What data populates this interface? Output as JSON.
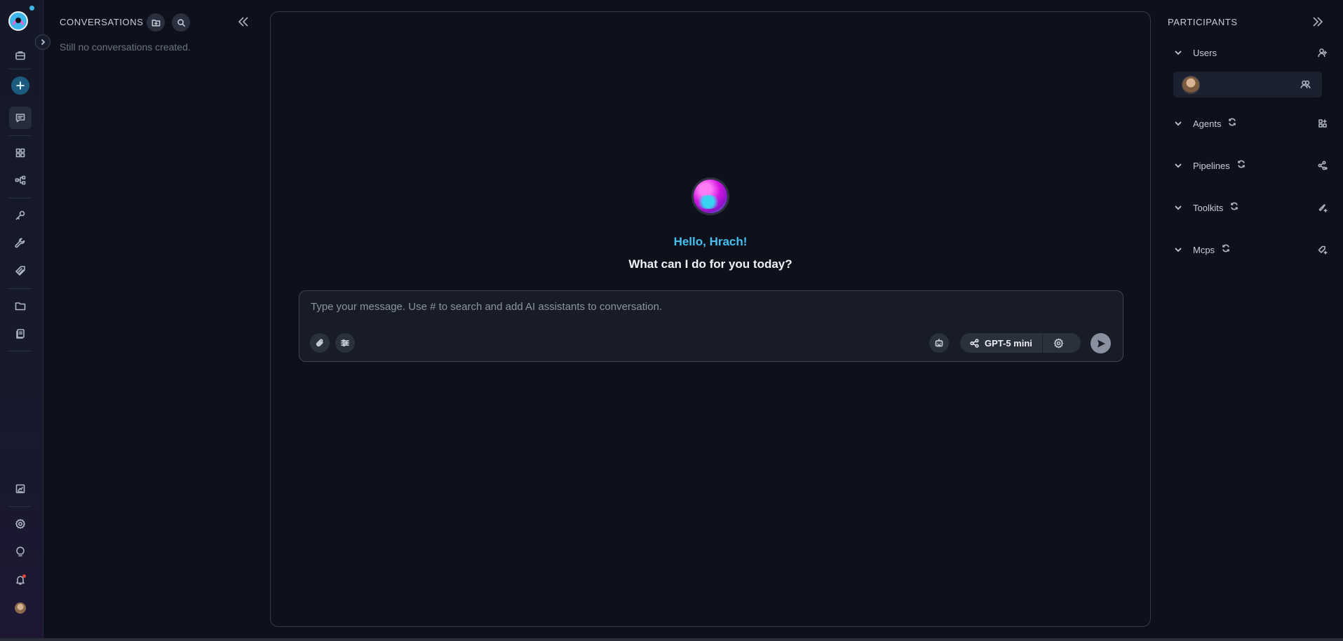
{
  "sidebar": {
    "items": [
      {
        "icon": "briefcase-icon"
      },
      {
        "icon": "plus-icon"
      },
      {
        "icon": "chat-icon",
        "active": true
      },
      {
        "icon": "grid-icon"
      },
      {
        "icon": "pipeline-icon"
      },
      {
        "icon": "key-icon"
      },
      {
        "icon": "wrench-icon"
      },
      {
        "icon": "tag-icon"
      },
      {
        "icon": "folder-icon"
      },
      {
        "icon": "document-icon"
      },
      {
        "icon": "report-icon"
      },
      {
        "icon": "settings-icon"
      },
      {
        "icon": "lightbulb-icon"
      },
      {
        "icon": "bell-icon"
      },
      {
        "icon": "avatar"
      }
    ]
  },
  "conversations": {
    "title": "CONVERSATIONS",
    "empty_text": "Still no conversations created."
  },
  "chat": {
    "greeting": "Hello, Hrach!",
    "prompt": "What can I do for you today?",
    "input": {
      "value": "",
      "placeholder": "Type your message. Use # to search and add AI assistants to conversation."
    },
    "model_label": "GPT-5 mini"
  },
  "participants": {
    "title": "PARTICIPANTS",
    "sections": {
      "users": "Users",
      "agents": "Agents",
      "pipelines": "Pipelines",
      "toolkits": "Toolkits",
      "mcps": "Mcps"
    }
  },
  "colors": {
    "background": "#0e111b",
    "accent": "#43c0f0",
    "panel_border": "#343a49",
    "muted_text": "#6b7282"
  }
}
